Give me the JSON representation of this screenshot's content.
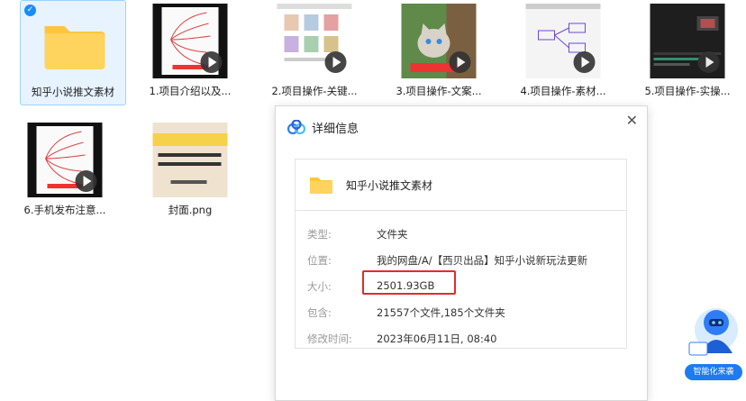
{
  "files": [
    {
      "name": "知乎小说推文素材",
      "type": "folder",
      "selected": true
    },
    {
      "name": "1.项目介绍以及...",
      "type": "video",
      "icon": "mindmap-thumbnail"
    },
    {
      "name": "2.项目操作-关键...",
      "type": "video",
      "icon": "webpage-thumbnail"
    },
    {
      "name": "3.项目操作-文案...",
      "type": "video",
      "icon": "kitten-thumbnail"
    },
    {
      "name": "4.项目操作-素材...",
      "type": "video",
      "icon": "diagram-thumbnail"
    },
    {
      "name": "5.项目操作-实操...",
      "type": "video",
      "icon": "dark-editor-thumbnail"
    },
    {
      "name": "6.手机发布注意...",
      "type": "video",
      "icon": "mindmap-thumbnail"
    },
    {
      "name": "封面.png",
      "type": "image",
      "icon": "cover-image-thumbnail"
    }
  ],
  "dialog": {
    "title": "详细信息",
    "folder_name": "知乎小说推文素材",
    "rows": [
      {
        "label": "类型:",
        "value": "文件夹"
      },
      {
        "label": "位置:",
        "value": "我的网盘/A/【西贝出品】知乎小说新玩法更新"
      },
      {
        "label": "大小:",
        "value": "2501.93GB"
      },
      {
        "label": "包含:",
        "value": "21557个文件,185个文件夹"
      },
      {
        "label": "修改时间:",
        "value": "2023年06月11日, 08:40"
      }
    ],
    "close_symbol": "✕"
  },
  "assistant": {
    "label": "智能化来袭"
  },
  "colors": {
    "accent": "#1a8cff",
    "highlight": "#e32b2b",
    "folder": "#ffc53d"
  }
}
